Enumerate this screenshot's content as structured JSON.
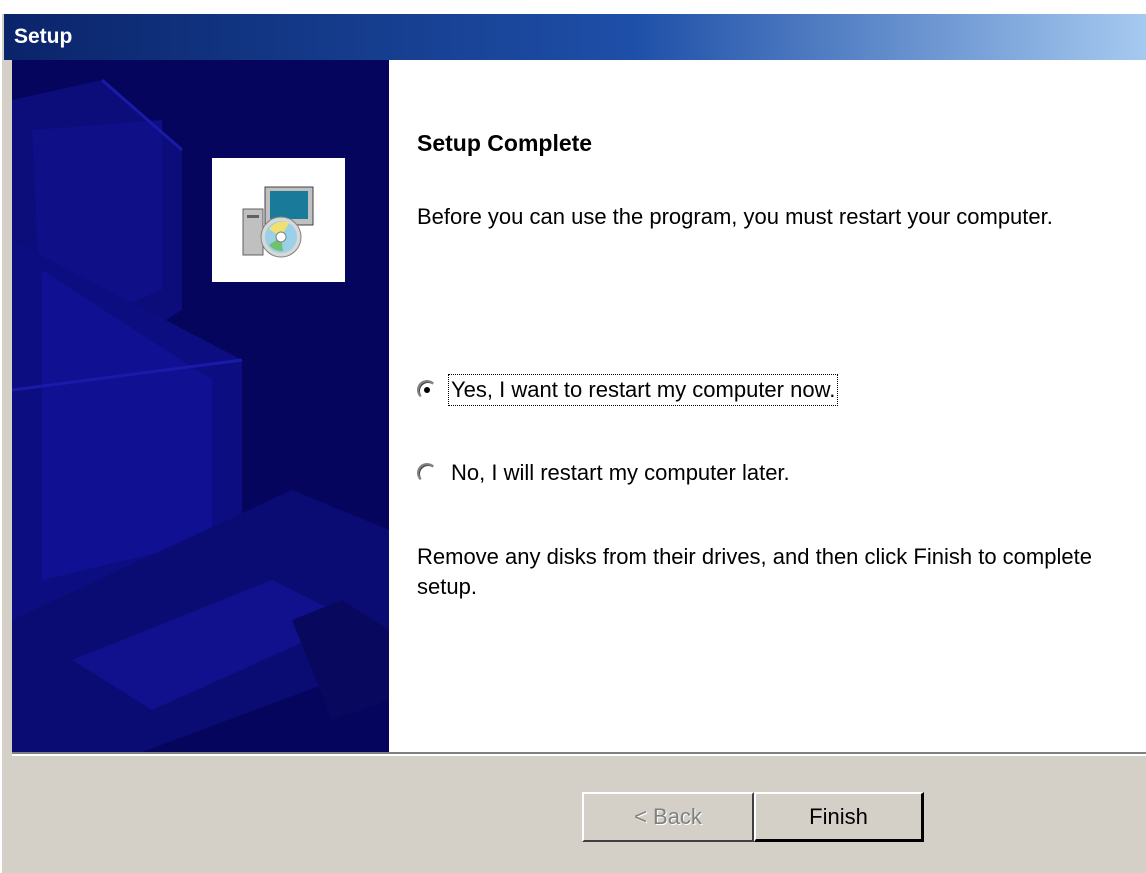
{
  "window": {
    "title": "Setup"
  },
  "main": {
    "heading": "Setup Complete",
    "intro": "Before you can use the program, you must restart your computer.",
    "options": [
      {
        "label": "Yes, I want to restart my computer now.",
        "checked": true
      },
      {
        "label": "No, I will restart my computer later.",
        "checked": false
      }
    ],
    "instructions": "Remove any disks from their drives, and then click Finish to complete setup."
  },
  "buttons": {
    "back_label": "< Back",
    "finish_label": "Finish"
  },
  "icons": {
    "logo": "setup-computer-cd-icon"
  },
  "colors": {
    "title_start": "#0a246a",
    "title_end": "#a6caf0",
    "sidebar": "#05055e",
    "face": "#d4d0c8"
  }
}
